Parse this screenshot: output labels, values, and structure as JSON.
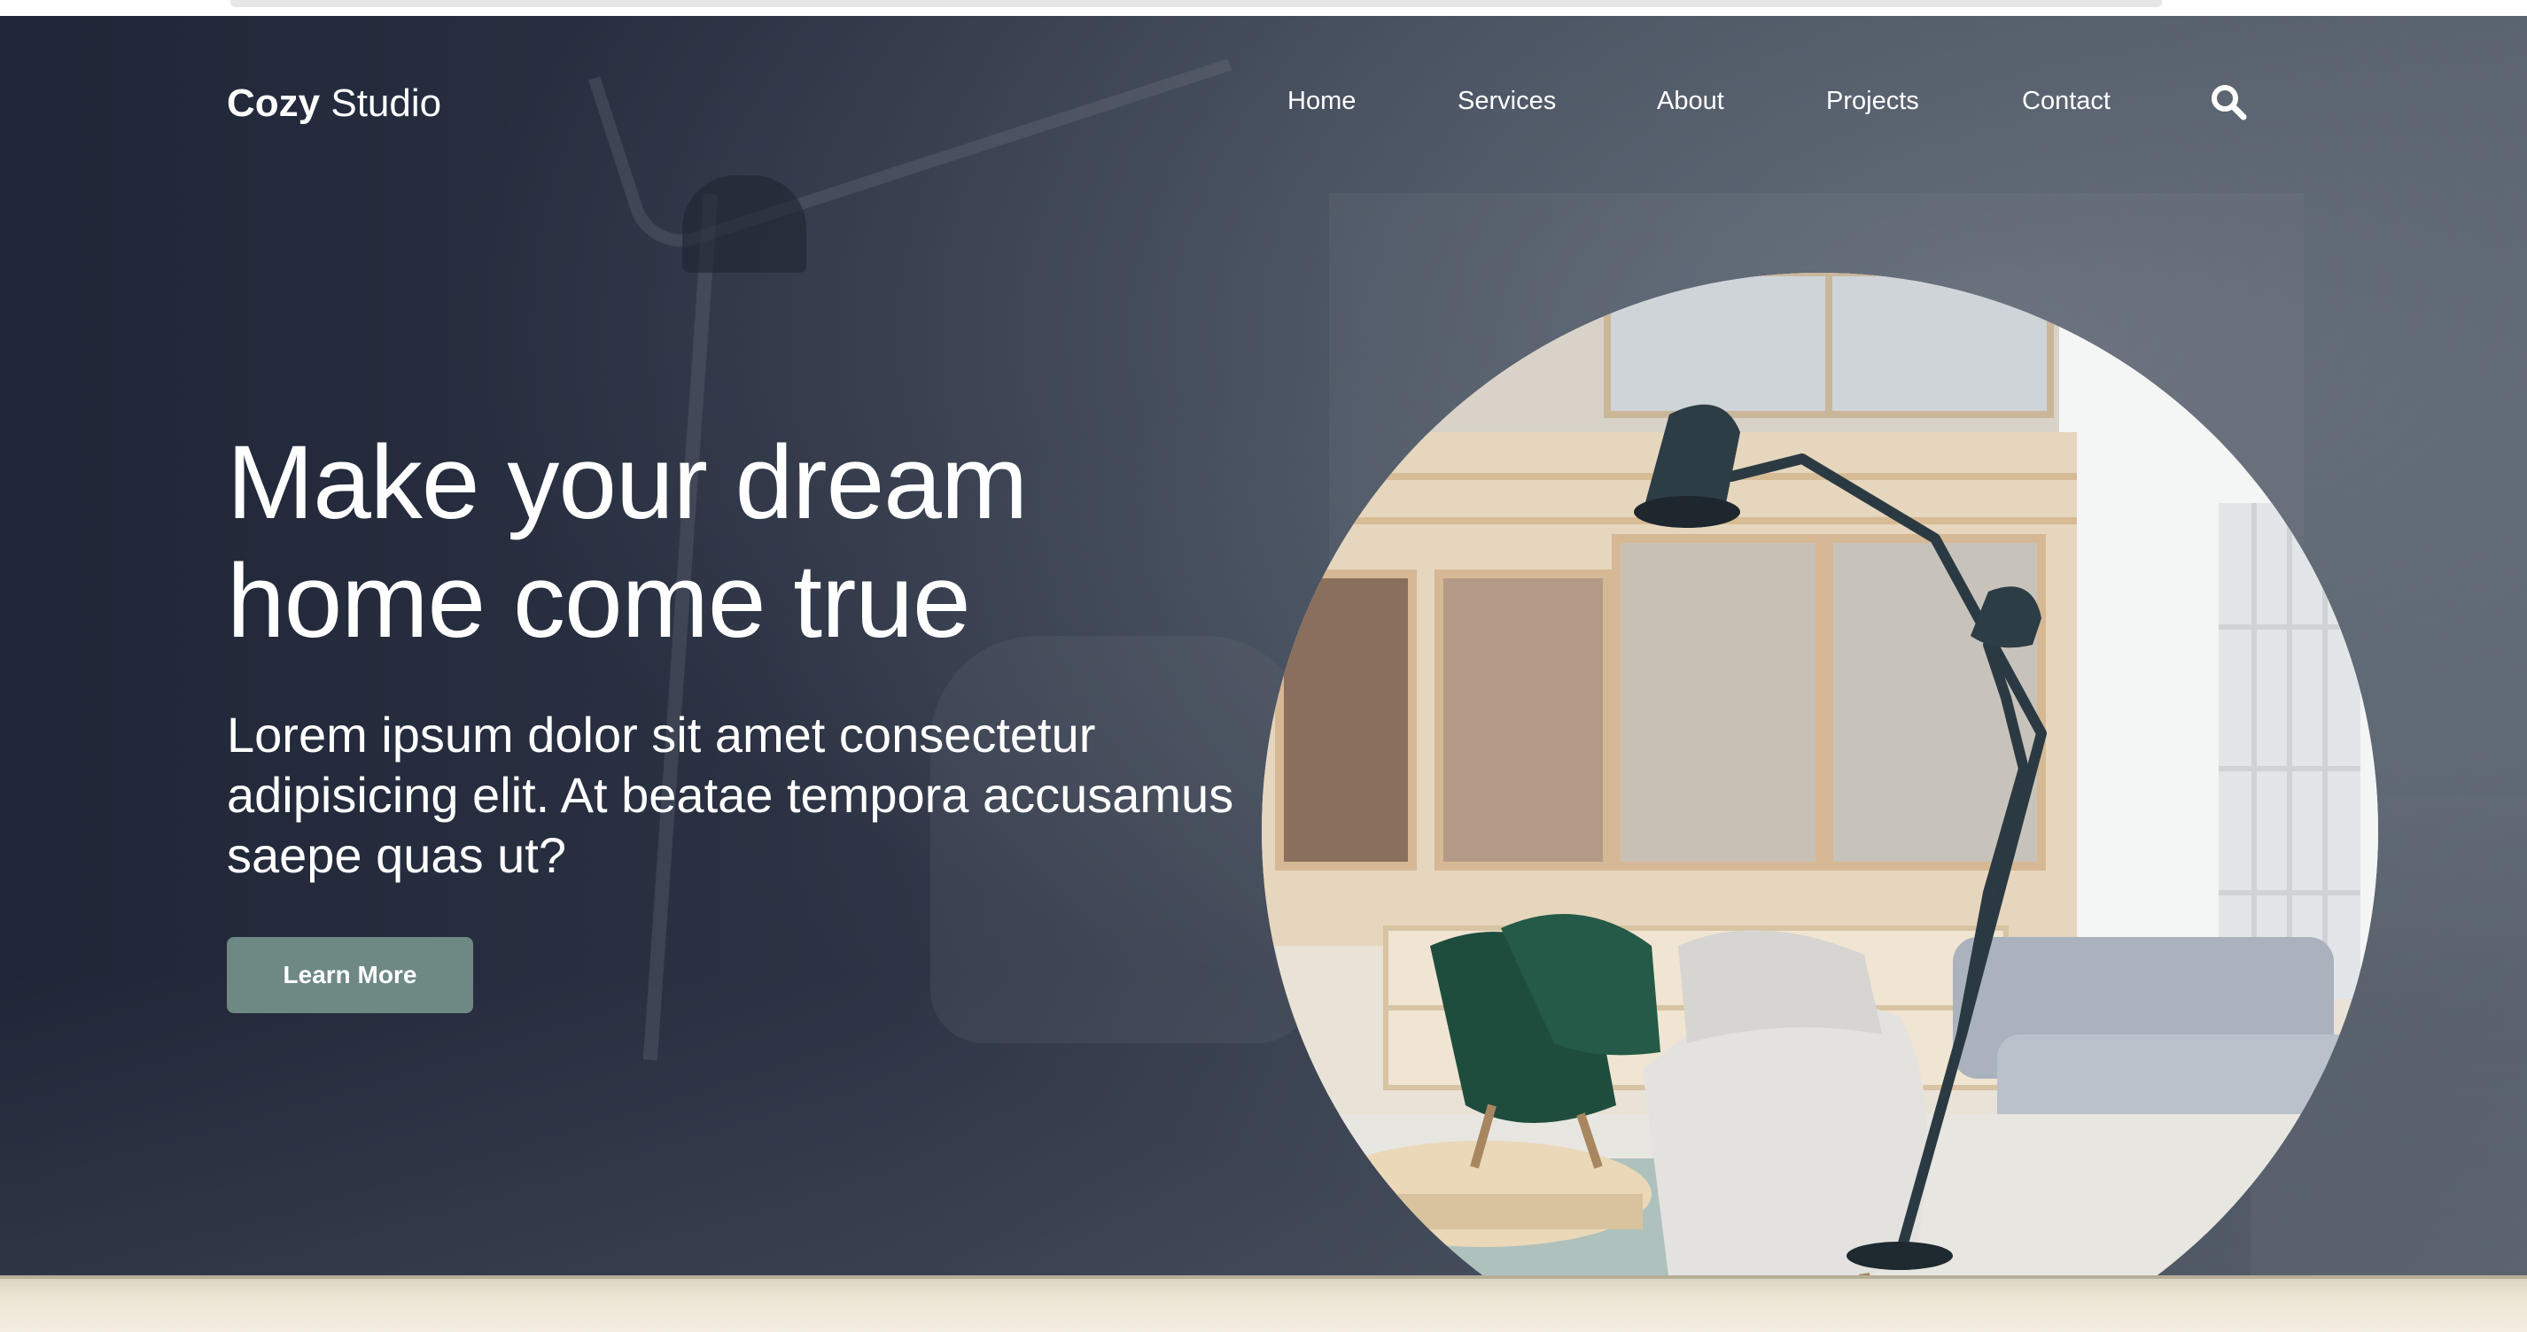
{
  "nav": {
    "logo_bold": "Cozy",
    "logo_rest": " Studio",
    "links": [
      {
        "label": "Home"
      },
      {
        "label": "Services"
      },
      {
        "label": "About"
      },
      {
        "label": "Projects"
      },
      {
        "label": "Contact"
      }
    ],
    "search_icon": "search-icon"
  },
  "hero": {
    "headline_line1": "Make your dream",
    "headline_line2": "home come true",
    "subtext": "Lorem ipsum dolor sit amet consectetur adipisicing elit. At beatae tempora accusamus saepe quas ut?",
    "cta_label": "Learn More",
    "photo": "living-room-with-lamp-and-chairs"
  },
  "colors": {
    "overlay": "#2c3344",
    "cta_background": "#6e8983",
    "text": "#ffffff"
  }
}
